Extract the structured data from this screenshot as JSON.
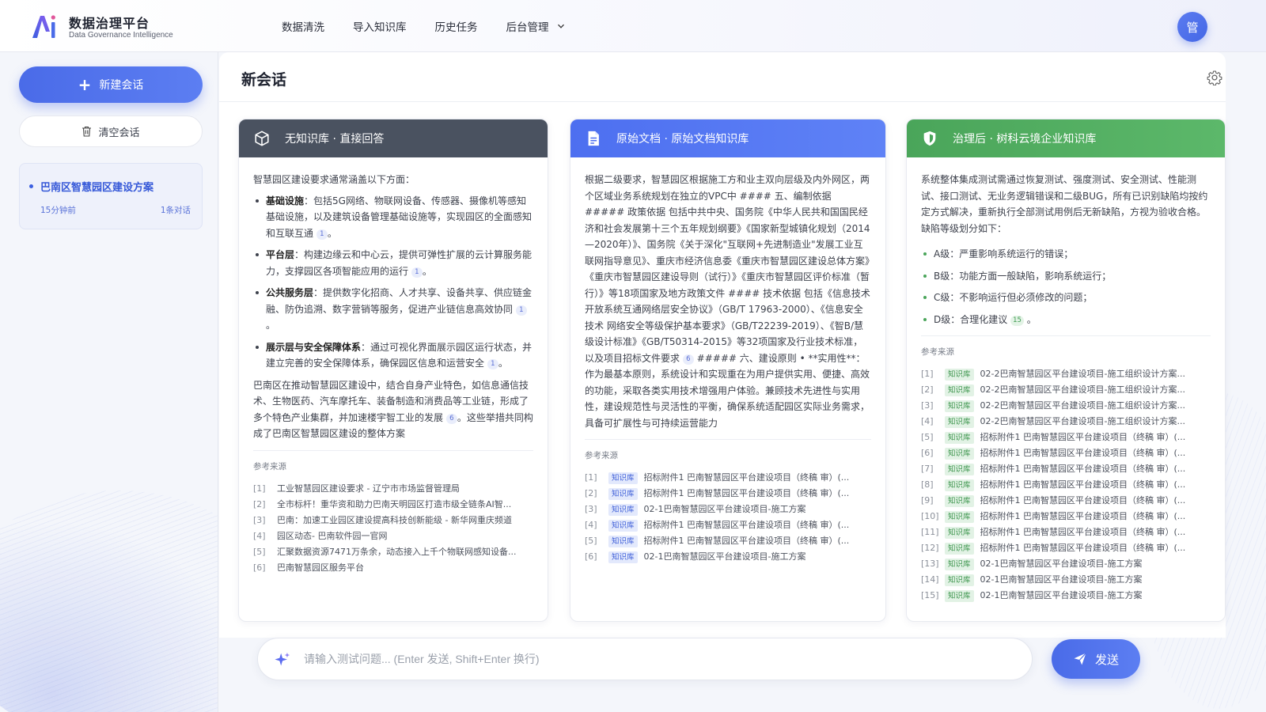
{
  "brand": {
    "title": "数据治理平台",
    "subtitle": "Data Governance Intelligence"
  },
  "nav": {
    "items": [
      "数据清洗",
      "导入知识库",
      "历史任务",
      "后台管理"
    ]
  },
  "user": {
    "avatar_text": "管"
  },
  "sidebar": {
    "new_chat_label": "新建会话",
    "clear_label": "清空会话",
    "sessions": [
      {
        "title": "巴南区智慧园区建设方案",
        "time": "15分钟前",
        "count": "1条对话"
      }
    ]
  },
  "main": {
    "title": "新会话"
  },
  "columns": [
    {
      "title": "无知识库 · 直接回答",
      "intro": "智慧园区建设要求通常涵盖以下方面：",
      "bullets": [
        {
          "label": "基础设施",
          "text": "：包括5G网络、物联网设备、传感器、摄像机等感知基础设施，以及建筑设备管理基础设施等，实现园区的全面感知和互联互通",
          "cite": "1"
        },
        {
          "label": "平台层",
          "text": "：构建边缘云和中心云，提供可弹性扩展的云计算服务能力，支撑园区各项智能应用的运行",
          "cite": "1"
        },
        {
          "label": "公共服务层",
          "text": "：提供数字化招商、人才共享、设备共享、供应链金融、防伪追溯、数字营销等服务，促进产业链信息高效协同",
          "cite": "1"
        },
        {
          "label": "展示层与安全保障体系",
          "text": "：通过可视化界面展示园区运行状态，并建立完善的安全保障体系，确保园区信息和运营安全",
          "cite": "1"
        }
      ],
      "paragraph": "巴南区在推动智慧园区建设中，结合自身产业特色，如信息通信技术、生物医药、汽车摩托车、装备制造和消费品等工业链，形成了多个特色产业集群，并加速楼宇智工业的发展",
      "paragraph_cite": "6",
      "paragraph_tail": "。这些举措共同构成了巴南区智慧园区建设的整体方案",
      "sources_title": "参考来源",
      "sources": [
        {
          "idx": "[1]",
          "text": "工业智慧园区建设要求 - 辽宁市市场监督管理局"
        },
        {
          "idx": "[2]",
          "text": "全市标杆！重华资和助力巴南天明园区打造市级全链条AI智..."
        },
        {
          "idx": "[3]",
          "text": "巴南：加速工业园区建设提高科技创新能级 - 新华网重庆频道"
        },
        {
          "idx": "[4]",
          "text": "园区动态- 巴南软件园一官网"
        },
        {
          "idx": "[5]",
          "text": "汇聚数据资源7471万条余，动态接入上千个物联网感知设备..."
        },
        {
          "idx": "[6]",
          "text": "巴南智慧园区服务平台"
        }
      ]
    },
    {
      "title": "原始文档 · 原始文档知识库",
      "body": "根据二级要求，智慧园区根据施工方和业主双向层级及内外网区，两个区域业务系统规划在独立的VPC中 #### 五、编制依据 ##### 政策依据 包括中共中央、国务院《中华人民共和国国民经济和社会发展第十三个五年规划纲要》《国家新型城镇化规划（2014—2020年）》、国务院《关于深化\"互联网+先进制造业\"发展工业互联网指导意见》、重庆市经济信息委《重庆市智慧园区建设总体方案》《重庆市智慧园区建设导则（试行）》《重庆市智慧园区评价标准（暂行）》等18项国家及地方政策文件 #### 技术依据 包括《信息技术开放系统互通网络层安全协议》（GB/T 17963-2000）、《信息安全技术 网络安全等级保护基本要求》（GB/T22239-2019）、《智B/慧级设计标准》《GB/T50314-2015》等32项国家及行业技术标准，以及项目招标文件要求",
      "body_cite": "6",
      "body_tail": "##### 六、建设原则 • **实用性**：作为最基本原则，系统设计和实现重在为用户提供实用、便捷、高效的功能，采取各类实用技术增强用户体验。兼顾技术先进性与实用性，建设规范性与灵活性的平衡，确保系统适配园区实际业务需求，具备可扩展性与可持续运营能力",
      "sources_title": "参考来源",
      "sources": [
        {
          "idx": "[1]",
          "tag": "知识库",
          "text": "招标附件1 巴南智慧园区平台建设项目（终稿 审）(..."
        },
        {
          "idx": "[2]",
          "tag": "知识库",
          "text": "招标附件1 巴南智慧园区平台建设项目（终稿 审）(..."
        },
        {
          "idx": "[3]",
          "tag": "知识库",
          "text": "02-1巴南智慧园区平台建设项目-施工方案"
        },
        {
          "idx": "[4]",
          "tag": "知识库",
          "text": "招标附件1 巴南智慧园区平台建设项目（终稿 审）(..."
        },
        {
          "idx": "[5]",
          "tag": "知识库",
          "text": "招标附件1 巴南智慧园区平台建设项目（终稿 审）(..."
        },
        {
          "idx": "[6]",
          "tag": "知识库",
          "text": "02-1巴南智慧园区平台建设项目-施工方案"
        }
      ]
    },
    {
      "title": "治理后 · 树科云境企业知识库",
      "body": "系统整体集成测试需通过恢复测试、强度测试、安全测试、性能测试、接口测试、无业务逻辑错误和二级BUG，所有已识别缺陷均按约定方式解决，重新执行全部测试用例后无新缺陷，方视为验收合格。缺陷等级划分如下：",
      "bullets": [
        {
          "text": "A级：严重影响系统运行的错误；"
        },
        {
          "text": "B级：功能方面一般缺陷，影响系统运行；"
        },
        {
          "text": "C级：不影响运行但必须修改的问题；"
        },
        {
          "text": "D级：合理化建议",
          "cite": "15",
          "tail": "。"
        }
      ],
      "sources_title": "参考来源",
      "sources": [
        {
          "idx": "[1]",
          "tag": "知识库",
          "text": "02-2巴南智慧园区平台建设项目-施工组织设计方案..."
        },
        {
          "idx": "[2]",
          "tag": "知识库",
          "text": "02-2巴南智慧园区平台建设项目-施工组织设计方案..."
        },
        {
          "idx": "[3]",
          "tag": "知识库",
          "text": "02-2巴南智慧园区平台建设项目-施工组织设计方案..."
        },
        {
          "idx": "[4]",
          "tag": "知识库",
          "text": "02-2巴南智慧园区平台建设项目-施工组织设计方案..."
        },
        {
          "idx": "[5]",
          "tag": "知识库",
          "text": "招标附件1 巴南智慧园区平台建设项目（终稿 审）(..."
        },
        {
          "idx": "[6]",
          "tag": "知识库",
          "text": "招标附件1 巴南智慧园区平台建设项目（终稿 审）(..."
        },
        {
          "idx": "[7]",
          "tag": "知识库",
          "text": "招标附件1 巴南智慧园区平台建设项目（终稿 审）(..."
        },
        {
          "idx": "[8]",
          "tag": "知识库",
          "text": "招标附件1 巴南智慧园区平台建设项目（终稿 审）(..."
        },
        {
          "idx": "[9]",
          "tag": "知识库",
          "text": "招标附件1 巴南智慧园区平台建设项目（终稿 审）(..."
        },
        {
          "idx": "[10]",
          "tag": "知识库",
          "text": "招标附件1 巴南智慧园区平台建设项目（终稿 审）(..."
        },
        {
          "idx": "[11]",
          "tag": "知识库",
          "text": "招标附件1 巴南智慧园区平台建设项目（终稿 审）(..."
        },
        {
          "idx": "[12]",
          "tag": "知识库",
          "text": "招标附件1 巴南智慧园区平台建设项目（终稿 审）(..."
        },
        {
          "idx": "[13]",
          "tag": "知识库",
          "text": "02-1巴南智慧园区平台建设项目-施工方案"
        },
        {
          "idx": "[14]",
          "tag": "知识库",
          "text": "02-1巴南智慧园区平台建设项目-施工方案"
        },
        {
          "idx": "[15]",
          "tag": "知识库",
          "text": "02-1巴南智慧园区平台建设项目-施工方案"
        }
      ]
    }
  ],
  "input": {
    "placeholder": "请输入测试问题... (Enter 发送, Shift+Enter 换行)",
    "send_label": "发送"
  },
  "colors": {
    "accent": "#4a6be8",
    "col1_head": "#4a5260",
    "col2_head": "#4d6ff0",
    "col3_head": "#4aa55a"
  }
}
